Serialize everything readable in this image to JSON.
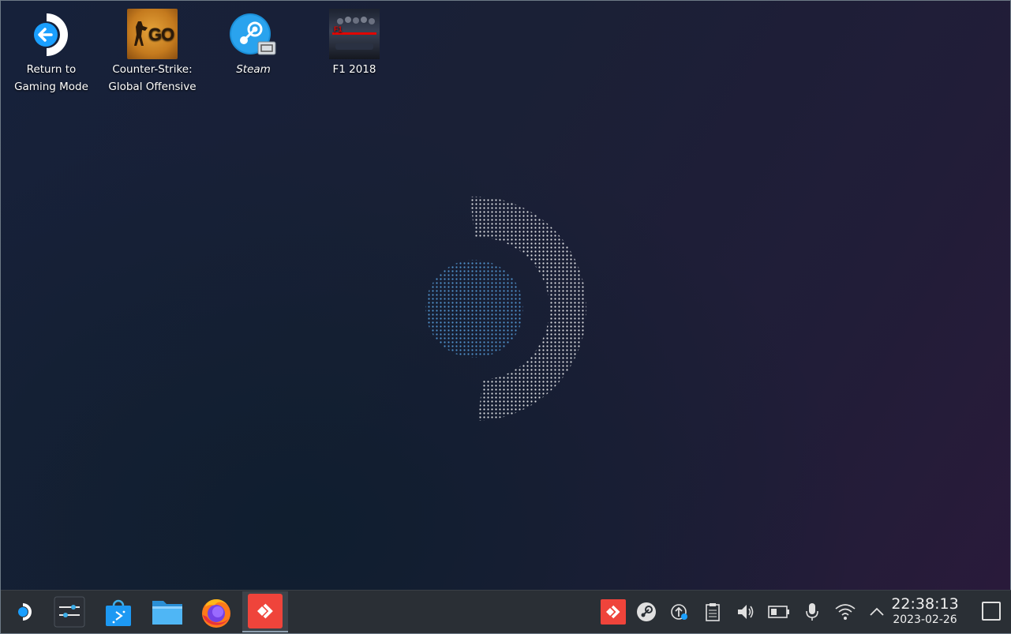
{
  "desktop": {
    "icons": [
      {
        "label_line1": "Return to",
        "label_line2": "Gaming Mode",
        "icon": "return-arrow-icon"
      },
      {
        "label_line1": "Counter-Strike:",
        "label_line2": "Global Offensive",
        "icon": "csgo-icon",
        "badge_text": "GO"
      },
      {
        "label_line1": "Steam",
        "label_line2": "",
        "icon": "steam-icon"
      },
      {
        "label_line1": "F1 2018",
        "label_line2": "",
        "icon": "f1-2018-icon"
      }
    ]
  },
  "taskbar": {
    "launcher_icon": "steamdeck-launcher-icon",
    "pinned": [
      {
        "name": "system-settings-icon"
      },
      {
        "name": "discover-store-icon"
      },
      {
        "name": "file-manager-icon"
      },
      {
        "name": "firefox-icon"
      },
      {
        "name": "anydesk-icon"
      }
    ],
    "tray": [
      {
        "name": "anydesk-tray-icon"
      },
      {
        "name": "steam-tray-icon"
      },
      {
        "name": "updates-icon"
      },
      {
        "name": "clipboard-icon"
      },
      {
        "name": "volume-icon"
      },
      {
        "name": "battery-icon"
      },
      {
        "name": "microphone-icon"
      },
      {
        "name": "wifi-icon"
      },
      {
        "name": "tray-expand-icon"
      }
    ],
    "clock_time": "22:38:13",
    "clock_date": "2023-02-26"
  },
  "colors": {
    "accent_blue": "#1a9fff",
    "anydesk_red": "#ef443b",
    "taskbar_bg": "#2a2f35"
  }
}
